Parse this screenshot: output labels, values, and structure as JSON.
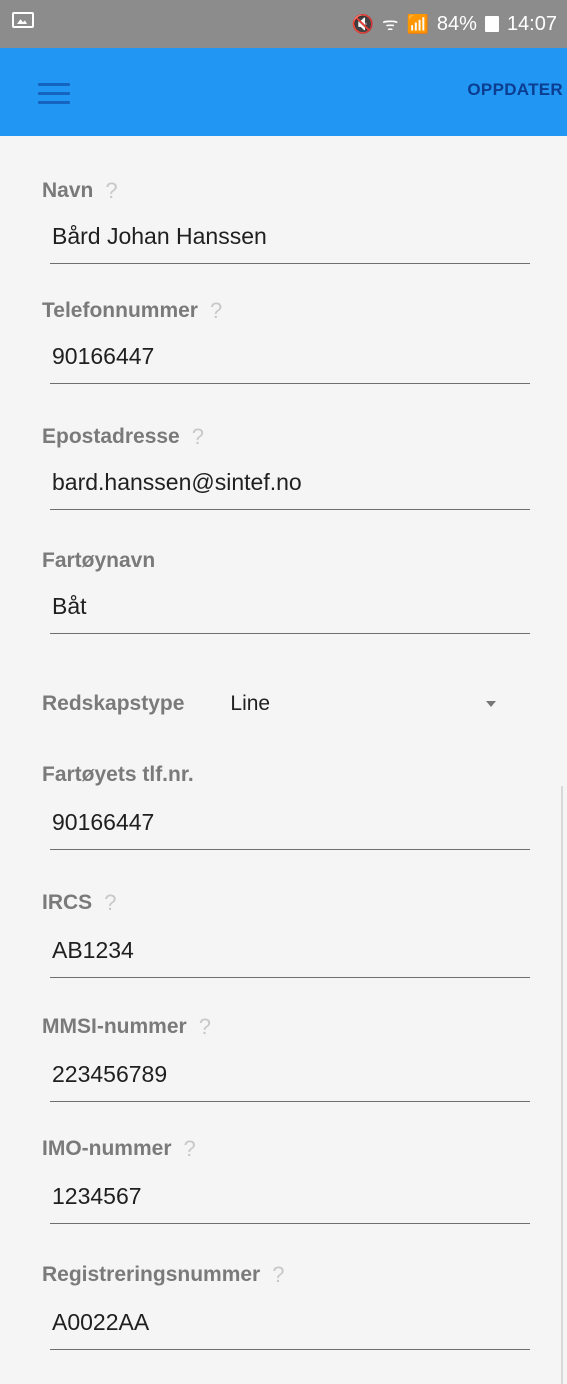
{
  "status_bar": {
    "left_icon": "image-notification-icon",
    "mute_glyph": "🔇",
    "wifi_glyph": "ᯤ",
    "signal_glyph": "📶",
    "battery_percent": "84%",
    "time": "14:07"
  },
  "app_bar": {
    "menu_icon": "hamburger-menu-icon",
    "update_label": "OPPDATER",
    "color": "#2196f3"
  },
  "form": {
    "name": {
      "label": "Navn",
      "value": "Bård Johan Hanssen",
      "help": "?"
    },
    "phone": {
      "label": "Telefonnummer",
      "value": "90166447",
      "help": "?"
    },
    "email": {
      "label": "Epostadresse",
      "value": "bard.hanssen@sintef.no",
      "help": "?"
    },
    "vessel_name": {
      "label": "Fartøynavn",
      "value": "Båt"
    },
    "gear_type": {
      "label": "Redskapstype",
      "value": "Line"
    },
    "vessel_phone": {
      "label": "Fartøyets tlf.nr.",
      "value": "90166447"
    },
    "ircs": {
      "label": "IRCS",
      "value": "AB1234",
      "help": "?"
    },
    "mmsi": {
      "label": "MMSI-nummer",
      "value": "223456789",
      "help": "?"
    },
    "imo": {
      "label": "IMO-nummer",
      "value": "1234567",
      "help": "?"
    },
    "registration": {
      "label": "Registreringsnummer",
      "value": "A0022AA",
      "help": "?"
    }
  }
}
